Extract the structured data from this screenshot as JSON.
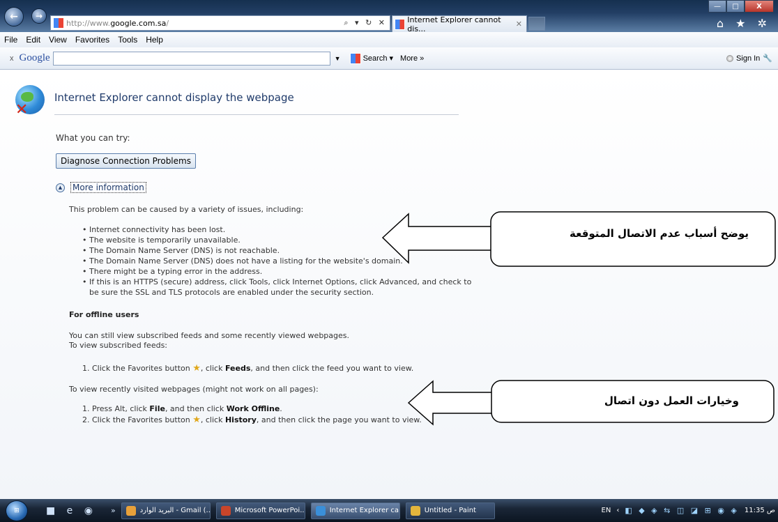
{
  "browser": {
    "url_prefix": "http://www.",
    "url_domain": "google.com.sa",
    "url_suffix": "/",
    "address_tools": "⌕ ▾ ↻ ✕",
    "tab_title": "Internet Explorer cannot dis...",
    "tab_close": "✕",
    "back_glyph": "←",
    "fwd_glyph": "→",
    "home_fav_tools": "⌂ ★ ✲"
  },
  "menu": [
    "File",
    "Edit",
    "View",
    "Favorites",
    "Tools",
    "Help"
  ],
  "google_toolbar": {
    "close": "x",
    "logo": "Google",
    "search_button": "Search ▾",
    "more": "More »",
    "sign_in": "Sign In"
  },
  "page": {
    "title": "Internet Explorer cannot display the webpage",
    "what_you_can_try": "What you can try:",
    "diagnose_button": "Diagnose Connection Problems",
    "more_information": "More information",
    "cause_intro": "This problem can be caused by a variety of issues, including:",
    "causes": [
      "Internet connectivity has been lost.",
      "The website is temporarily unavailable.",
      "The Domain Name Server (DNS) is not reachable.",
      "The Domain Name Server (DNS) does not have a listing for the website's domain.",
      "There might be a typing error in the address.",
      "If this is an HTTPS (secure) address, click Tools, click Internet Options, click Advanced, and check to be sure the SSL and TLS protocols are enabled under the security section."
    ],
    "offline_heading": "For offline users",
    "offline_text1": "You can still view subscribed feeds and some recently viewed webpages.",
    "offline_text2": "To view subscribed feeds:",
    "feeds_step": {
      "num": "1.",
      "a": "Click the Favorites button",
      "b": ", click ",
      "bold": "Feeds",
      "c": ", and then click the feed you want to view."
    },
    "recent_label": "To view recently visited webpages (might not work on all pages):",
    "offline_steps": [
      {
        "num": "1.",
        "a": "Press Alt, click ",
        "bold1": "File",
        "b": ", and then click ",
        "bold2": "Work Offline",
        "c": "."
      },
      {
        "num": "2.",
        "a": "Click the Favorites button",
        "b": ", click ",
        "bold1": "History",
        "c": ", and then click the page you want to view."
      }
    ]
  },
  "callouts": [
    {
      "label": "يوضح أسباب عدم الاتصال المتوقعة"
    },
    {
      "label": "وخيارات العمل دون اتصال"
    }
  ],
  "taskbar": {
    "start": "⊞",
    "quicklaunch": "■ e ◉",
    "more": "»",
    "tasks": [
      {
        "label": "البريد الوارد - Gmail (...",
        "icon_color": "#e8a13a",
        "active": false
      },
      {
        "label": "Microsoft PowerPoi...",
        "icon_color": "#c8452a",
        "active": false
      },
      {
        "label": "Internet Explorer ca...",
        "icon_color": "#3a8fd9",
        "active": true
      },
      {
        "label": "Untitled - Paint",
        "icon_color": "#e3b53c",
        "active": false
      }
    ],
    "lang": "EN",
    "tray_icons": "◧ ◆ ◈ ⇆ ◫ ◪ ⊞ ◉ ◈",
    "time": "ص 11:35"
  }
}
